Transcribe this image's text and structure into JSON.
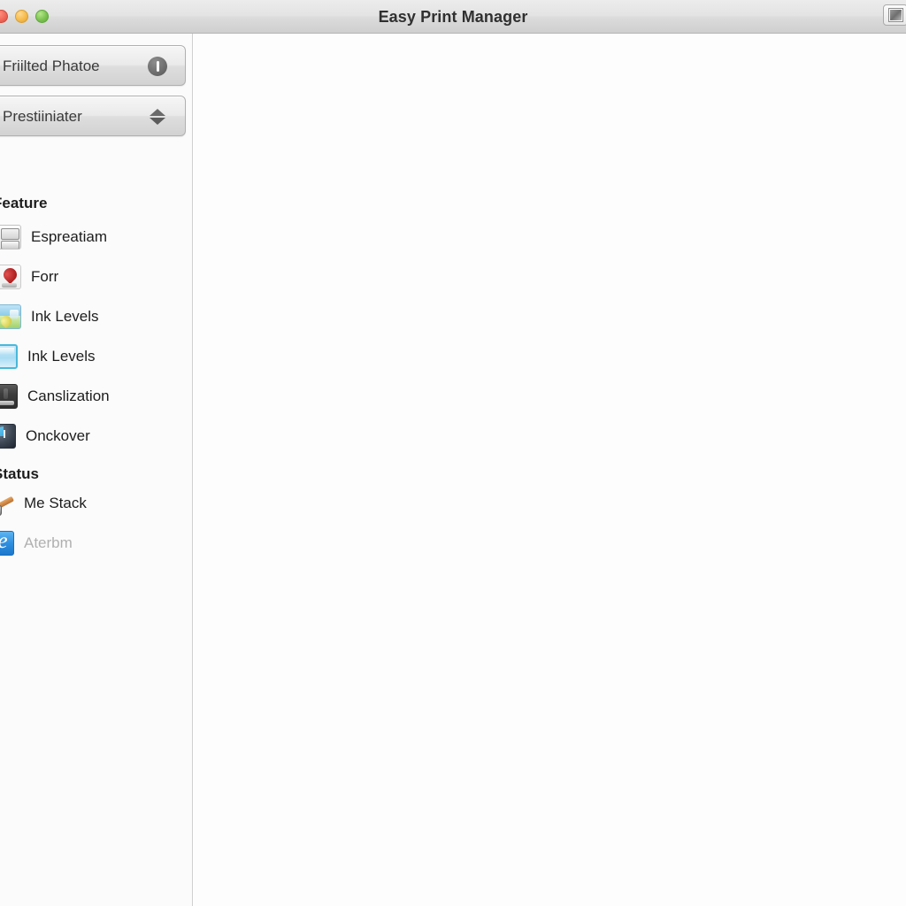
{
  "window": {
    "title": "Easy Print Manager",
    "traffic_lights": [
      {
        "name": "close",
        "color": "#f0685a"
      },
      {
        "name": "minimize",
        "color": "#f6bb4c"
      },
      {
        "name": "maximize",
        "color": "#7cc351"
      }
    ],
    "toolbar_right_button": {
      "icon": "image-thumbnail-icon"
    }
  },
  "sidebar": {
    "popups": [
      {
        "label": "Friilted Phatoe",
        "icon": "info-icon"
      },
      {
        "label": "Prestiiniater",
        "icon": "chevron-updown-icon"
      }
    ],
    "sections": [
      {
        "header": "Feature",
        "items": [
          {
            "label": "Espreatiam",
            "icon": "scanner-icon",
            "disabled": false
          },
          {
            "label": "Forr",
            "icon": "fax-icon",
            "disabled": false
          },
          {
            "label": "Ink Levels",
            "icon": "ink-levels-icon",
            "disabled": false
          },
          {
            "label": "Ink Levels",
            "icon": "ink-cartridge-icon",
            "disabled": false
          },
          {
            "label": "Canslization",
            "icon": "maintenance-icon",
            "disabled": false
          },
          {
            "label": "Onckover",
            "icon": "clock-icon",
            "disabled": false
          }
        ]
      },
      {
        "header": "Status",
        "items": [
          {
            "label": "Me Stack",
            "icon": "tool-stack-icon",
            "disabled": false
          },
          {
            "label": "Aterbm",
            "icon": "alert-e-icon",
            "disabled": true
          }
        ]
      }
    ]
  },
  "content": {
    "body": ""
  },
  "colors": {
    "titlebar_top": "#ececec",
    "titlebar_bottom": "#cfcfcf",
    "sidebar_bg": "#fbfbfb",
    "divider": "#cfcfcf",
    "content_bg": "#fdfdfd",
    "text": "#1d1d1d",
    "text_disabled": "#b0b0b0"
  }
}
